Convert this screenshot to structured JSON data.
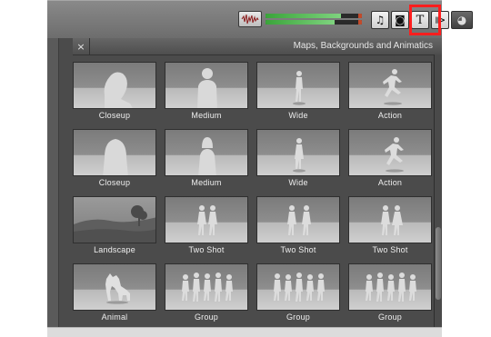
{
  "toolbar": {
    "waveform_icon": "waveform-icon",
    "buttons": [
      {
        "name": "music-icon",
        "glyph": "♫"
      },
      {
        "name": "camera-icon",
        "glyph": "◙"
      },
      {
        "name": "title-icon",
        "glyph": "T"
      },
      {
        "name": "transition-icon",
        "glyph": "⧐"
      },
      {
        "name": "globe-icon",
        "glyph": "◕"
      }
    ],
    "highlight_color": "#ff1e1e"
  },
  "panel": {
    "close_glyph": "×",
    "title": "Maps, Backgrounds and Animatics"
  },
  "tiles": [
    {
      "label": "Closeup",
      "icon": "closeup-silhouette-icon"
    },
    {
      "label": "Medium",
      "icon": "medium-silhouette-icon"
    },
    {
      "label": "Wide",
      "icon": "wide-silhouette-icon"
    },
    {
      "label": "Action",
      "icon": "running-figure-icon"
    },
    {
      "label": "Closeup",
      "icon": "closeup-silhouette-icon"
    },
    {
      "label": "Medium",
      "icon": "medium-silhouette-icon"
    },
    {
      "label": "Wide",
      "icon": "wide-silhouette-icon"
    },
    {
      "label": "Action",
      "icon": "running-figure-icon"
    },
    {
      "label": "Landscape",
      "icon": "landscape-tree-icon"
    },
    {
      "label": "Two Shot",
      "icon": "two-people-icon"
    },
    {
      "label": "Two Shot",
      "icon": "two-people-icon"
    },
    {
      "label": "Two Shot",
      "icon": "two-people-icon"
    },
    {
      "label": "Animal",
      "icon": "dog-icon"
    },
    {
      "label": "Group",
      "icon": "group-people-icon"
    },
    {
      "label": "Group",
      "icon": "group-people-icon"
    },
    {
      "label": "Group",
      "icon": "group-people-icon"
    }
  ]
}
